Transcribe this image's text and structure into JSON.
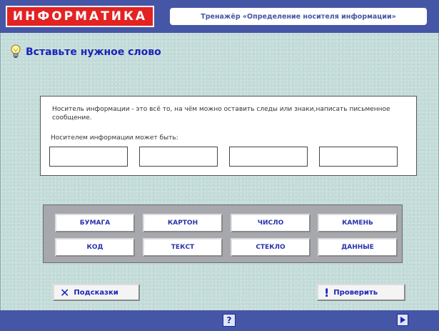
{
  "header": {
    "logo_text": "ИНФОРМАТИКА",
    "trainer_title": "Тренажёр «Определение носителя информации»"
  },
  "task": {
    "title": "Вставьте нужное слово"
  },
  "question": {
    "definition": "Носитель информации - это всё то, на чём можно оставить следы или знаки,написать письменное сообщение.",
    "prompt": "Носителем информации может быть:",
    "answer_slots": [
      "",
      "",
      "",
      ""
    ]
  },
  "word_bank": {
    "words": [
      "БУМАГА",
      "КАРТОН",
      "ЧИСЛО",
      "КАМЕНЬ",
      "КОД",
      "ТЕКСТ",
      "СТЕКЛО",
      "ДАННЫЕ"
    ]
  },
  "actions": {
    "hints_label": "Подсказки",
    "check_label": "Проверить"
  },
  "footer": {
    "help_label": "?"
  },
  "colors": {
    "header_bg": "#4656a6",
    "logo_bg": "#e32222",
    "accent_text": "#1a24b8"
  }
}
